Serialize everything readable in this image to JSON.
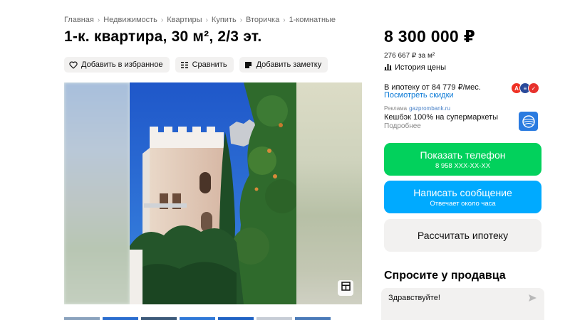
{
  "breadcrumbs": [
    "Главная",
    "Недвижимость",
    "Квартиры",
    "Купить",
    "Вторичка",
    "1-комнатные"
  ],
  "title": "1-к. квартира, 30 м², 2/3 эт.",
  "actions": {
    "favorite": "Добавить в избранное",
    "compare": "Сравнить",
    "note": "Добавить заметку"
  },
  "price": {
    "total": "8 300 000 ₽",
    "per_m2": "276 667 ₽ за м²",
    "history": "История цены"
  },
  "mortgage": {
    "text": "В ипотеку от 84 779 ₽/мес.",
    "link": "Посмотреть скидки"
  },
  "ad": {
    "label": "Реклама",
    "domain": "gazprombank.ru",
    "title": "Кешбэк 100% на супермаркеты",
    "more": "Подробнее"
  },
  "buttons": {
    "phone": "Показать телефон",
    "phone_number": "8 958 XXX-XX-XX",
    "message": "Написать сообщение",
    "message_sub": "Отвечает около часа",
    "mortgage_calc": "Рассчитать ипотеку"
  },
  "ask": {
    "title": "Спросите у продавца",
    "message": "Здравствуйте!"
  },
  "icons": {
    "favorite": "heart-icon",
    "compare": "compare-icon",
    "note": "note-icon",
    "history": "bar-chart-icon",
    "gallery": "gallery-grid-icon",
    "send": "send-icon"
  },
  "colors": {
    "phone_button": "#02d15c",
    "message_button": "#00aaff",
    "link": "#0a79d6"
  }
}
